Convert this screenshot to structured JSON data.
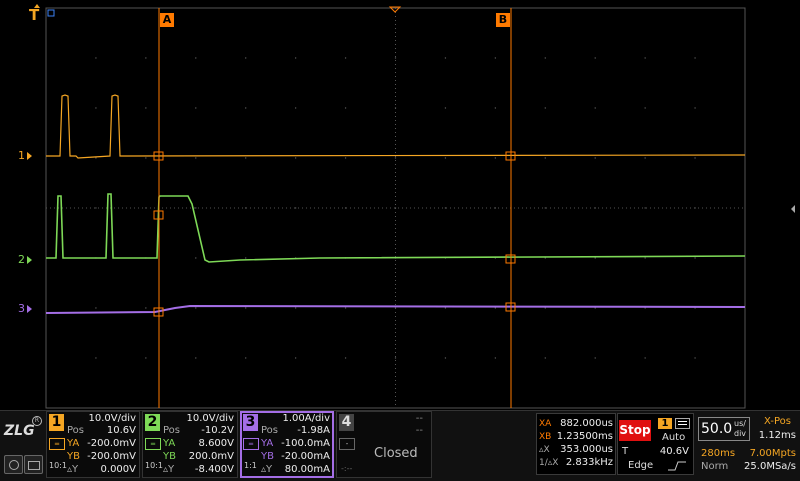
{
  "markers": {
    "cursor_a": "A",
    "cursor_b": "B",
    "ch1": "1",
    "ch2": "2",
    "ch3": "3",
    "trigger": "T"
  },
  "brand": "ZLG",
  "channels": [
    {
      "num": "1",
      "color": "#f5a623",
      "scale": "10.0V/div",
      "pos_label": "Pos",
      "pos": "10.6V",
      "ya_label": "YA",
      "ya": "-200.0mV",
      "yb_label": "YB",
      "yb": "-200.0mV",
      "dy_label": "▵Y",
      "dy": "0.000V",
      "coupling": "10:1"
    },
    {
      "num": "2",
      "color": "#7ed957",
      "scale": "10.0V/div",
      "pos_label": "Pos",
      "pos": "-10.2V",
      "ya_label": "YA",
      "ya": "8.600V",
      "yb_label": "YB",
      "yb": "200.0mV",
      "dy_label": "▵Y",
      "dy": "-8.400V",
      "coupling": "10:1"
    },
    {
      "num": "3",
      "color": "#a46ee6",
      "scale": "1.00A/div",
      "pos_label": "Pos",
      "pos": "-1.98A",
      "ya_label": "YA",
      "ya": "-100.0mA",
      "yb_label": "YB",
      "yb": "-20.00mA",
      "dy_label": "▵Y",
      "dy": "80.00mA",
      "coupling": "1:1"
    },
    {
      "num": "4",
      "color": "#555555",
      "scale": "--",
      "pos": "--",
      "ya": "--",
      "yb": "--",
      "status": "Closed",
      "dash": "-"
    }
  ],
  "cursor_readout": {
    "xa_label": "XA",
    "xa": "882.000us",
    "xb_label": "XB",
    "xb": "1.23500ms",
    "dx_label": "▵X",
    "dx": "353.000us",
    "inv_label": "1/▵X",
    "inv": "2.833kHz"
  },
  "run": {
    "state": "Stop",
    "trig_source": "1",
    "trig_mode": "Auto",
    "trig_level_label": "T",
    "trig_level": "40.6V",
    "trig_type": "Edge"
  },
  "timebase": {
    "value": "50.0",
    "unit_top": "us/",
    "unit_bottom": "div",
    "xpos_label": "X-Pos",
    "xpos": "1.12ms",
    "win": "280ms",
    "mpts": "7.00Mpts",
    "acq": "Norm",
    "rate": "25.0MSa/s"
  },
  "colors": {
    "ch1": "#f5a623",
    "ch2": "#7ed957",
    "ch3": "#a46ee6",
    "cursor": "#ff7a00",
    "stop": "#e01010",
    "grid": "#3a3a3a"
  }
}
